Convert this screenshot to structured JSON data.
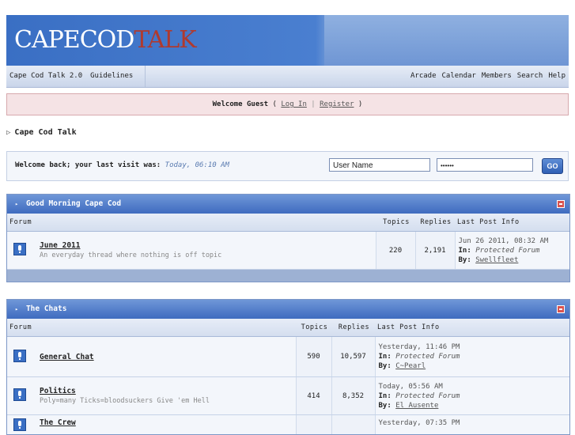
{
  "header": {
    "logo_part1": "CAPECOD",
    "logo_part2": "TALK"
  },
  "navbar": {
    "left": [
      "Cape Cod Talk 2.0",
      "Guidelines"
    ],
    "right": [
      "Arcade",
      "Calendar",
      "Members",
      "Search",
      "Help"
    ]
  },
  "guest": {
    "prefix": "Welcome Guest",
    "open": "(",
    "login": "Log In",
    "divider": "|",
    "register": "Register",
    "close": ")"
  },
  "breadcrumb": {
    "label": "Cape Cod Talk"
  },
  "login": {
    "message": "Welcome back; your last visit was:",
    "last_visit": "Today, 06:10 AM",
    "username_value": "User Name",
    "password_value": "••••••",
    "go_label": "GO"
  },
  "categories": [
    {
      "title": "Good Morning Cape Cod",
      "columns": {
        "forum": "Forum",
        "topics": "Topics",
        "replies": "Replies",
        "last": "Last Post Info"
      },
      "forums": [
        {
          "name": "June 2011",
          "description": "An everyday thread where nothing is off topic",
          "topics": "220",
          "replies": "2,191",
          "last_date": "Jun 26 2011, 08:32 AM",
          "last_in_label": "In:",
          "last_in": "Protected Forum",
          "last_by_label": "By:",
          "last_by": "Swellfleet"
        }
      ]
    },
    {
      "title": "The Chats",
      "columns": {
        "forum": "Forum",
        "topics": "Topics",
        "replies": "Replies",
        "last": "Last Post Info"
      },
      "forums": [
        {
          "name": "General Chat",
          "description": "",
          "topics": "590",
          "replies": "10,597",
          "last_date": "Yesterday, 11:46 PM",
          "last_in_label": "In:",
          "last_in": "Protected Forum",
          "last_by_label": "By:",
          "last_by": "C~Pearl"
        },
        {
          "name": "Politics",
          "description": "Poly=many Ticks=bloodsuckers Give 'em Hell",
          "topics": "414",
          "replies": "8,352",
          "last_date": "Today, 05:56 AM",
          "last_in_label": "In:",
          "last_in": "Protected Forum",
          "last_by_label": "By:",
          "last_by": "El Ausente"
        },
        {
          "name": "The Crew",
          "description": "",
          "topics": "",
          "replies": "",
          "last_date": "Yesterday, 07:35 PM",
          "last_in_label": "",
          "last_in": "",
          "last_by_label": "",
          "last_by": ""
        }
      ]
    }
  ]
}
